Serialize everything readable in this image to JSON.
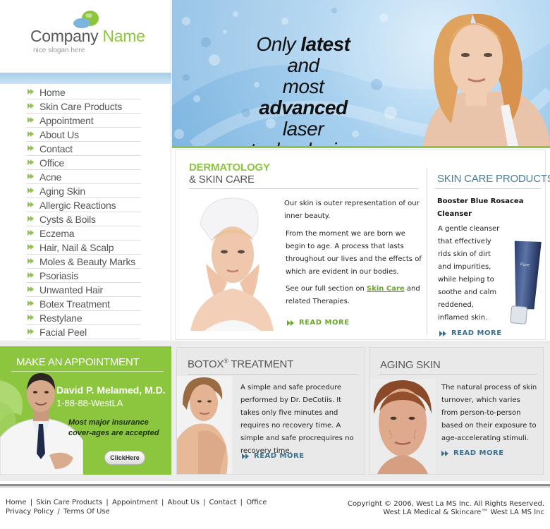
{
  "brand": {
    "company_word": "Company",
    "name_word": "Name",
    "slogan": "nice slogan here",
    "accent_color": "#8cc63f",
    "logo_icon": "green-blue-pill-icon"
  },
  "hero": {
    "line1_pre": "Only ",
    "line1_bold": "latest",
    "line1_post": " and",
    "line2": "most",
    "line3_bold": "advanced",
    "line3_post": " laser",
    "line4": "technologies"
  },
  "nav": {
    "items": [
      {
        "label": "Home"
      },
      {
        "label": "Skin Care Products"
      },
      {
        "label": "Appointment"
      },
      {
        "label": "About Us"
      },
      {
        "label": "Contact"
      },
      {
        "label": "Office"
      },
      {
        "label": "Acne"
      },
      {
        "label": "Aging Skin"
      },
      {
        "label": "Allergic Reactions"
      },
      {
        "label": "Cysts & Boils"
      },
      {
        "label": "Eczema"
      },
      {
        "label": "Hair, Nail & Scalp"
      },
      {
        "label": "Moles & Beauty Marks"
      },
      {
        "label": "Psoriasis"
      },
      {
        "label": "Unwanted Hair"
      },
      {
        "label": "Botex Treatment"
      },
      {
        "label": "Restylane"
      },
      {
        "label": "Facial Peel"
      }
    ]
  },
  "dermatology": {
    "title_line1": "DERMATOLOGY",
    "title_line2": "& SKIN CARE",
    "p1": "Our skin is outer representation of our inner beauty.",
    "p2": "From the moment we are born we begin to age. A process that lasts throughout our lives and the effects of which are evident in our bodies.",
    "p3_pre": "See our full section on ",
    "p3_link": "Skin Care",
    "p3_post": " and related Therapies.",
    "read_more": "READ MORE"
  },
  "skin_products": {
    "title": "SKIN CARE PRODUCTS",
    "product_name": "Booster Blue Rosacea Cleanser",
    "description": "A gentle cleanser that effectively rids skin of dirt and impurities, while helping to soothe and calm reddened, inflamed skin.",
    "tube_label": "Pure",
    "read_more": "READ MORE"
  },
  "appointment": {
    "title": "MAKE AN APPOINTMENT",
    "doctor_name": "David P. Melamed, M.D.",
    "phone": "1-88-88-WestLA",
    "note": "Most major insurance cover-ages are accepted",
    "button": "ClickHere"
  },
  "botox": {
    "title": "BOTOX",
    "title_sup": "®",
    "title_post": " TREATMENT",
    "text": "A simple and safe procedure performed by Dr. DeCotiis. It takes only five minutes and requires no recovery time.  A simple and safe procrequires no recovery time.",
    "read_more": "READ MORE"
  },
  "aging": {
    "title": "AGING SKIN",
    "text": "The natural process of skin turnover, which varies from person-to-person based on their exposure to age-accelerating stimuli.",
    "read_more": "READ MORE"
  },
  "footer": {
    "links": [
      "Home",
      "Skin Care Products",
      "Appointment",
      "About Us",
      "Contact",
      "Office"
    ],
    "privacy": "Privacy Policy",
    "terms": "Terms Of Use",
    "copyright_line1": "Copyright © 2006, West La MS Inc. All Rights Reserved.",
    "copyright_line2": "West LA Medical & Skincare™ West LA MS Inc"
  }
}
